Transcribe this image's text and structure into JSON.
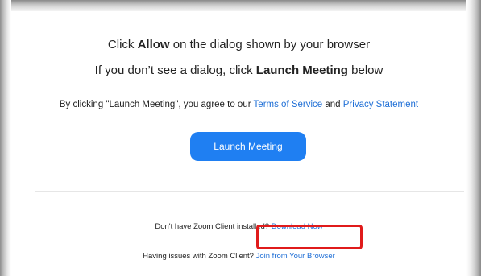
{
  "prompt": {
    "line1_prefix": "Click ",
    "line1_bold": "Allow",
    "line1_suffix": " on the dialog shown by your browser",
    "line2_prefix": "If you don’t see a dialog, click ",
    "line2_bold": "Launch Meeting",
    "line2_suffix": " below"
  },
  "terms": {
    "prefix": "By clicking \"Launch Meeting\", you agree to our ",
    "terms_link": "Terms of Service",
    "middle": " and ",
    "privacy_link": "Privacy Statement"
  },
  "launch_button": {
    "label": "Launch Meeting"
  },
  "footer": {
    "download_prefix": "Don't have Zoom Client installed? ",
    "download_link": "Download Now",
    "browser_prefix": "Having issues with Zoom Client? ",
    "browser_link": "Join from Your Browser"
  },
  "colors": {
    "accent": "#1f7ff2",
    "link": "#1f6fd6",
    "highlight": "#e01b1b"
  }
}
